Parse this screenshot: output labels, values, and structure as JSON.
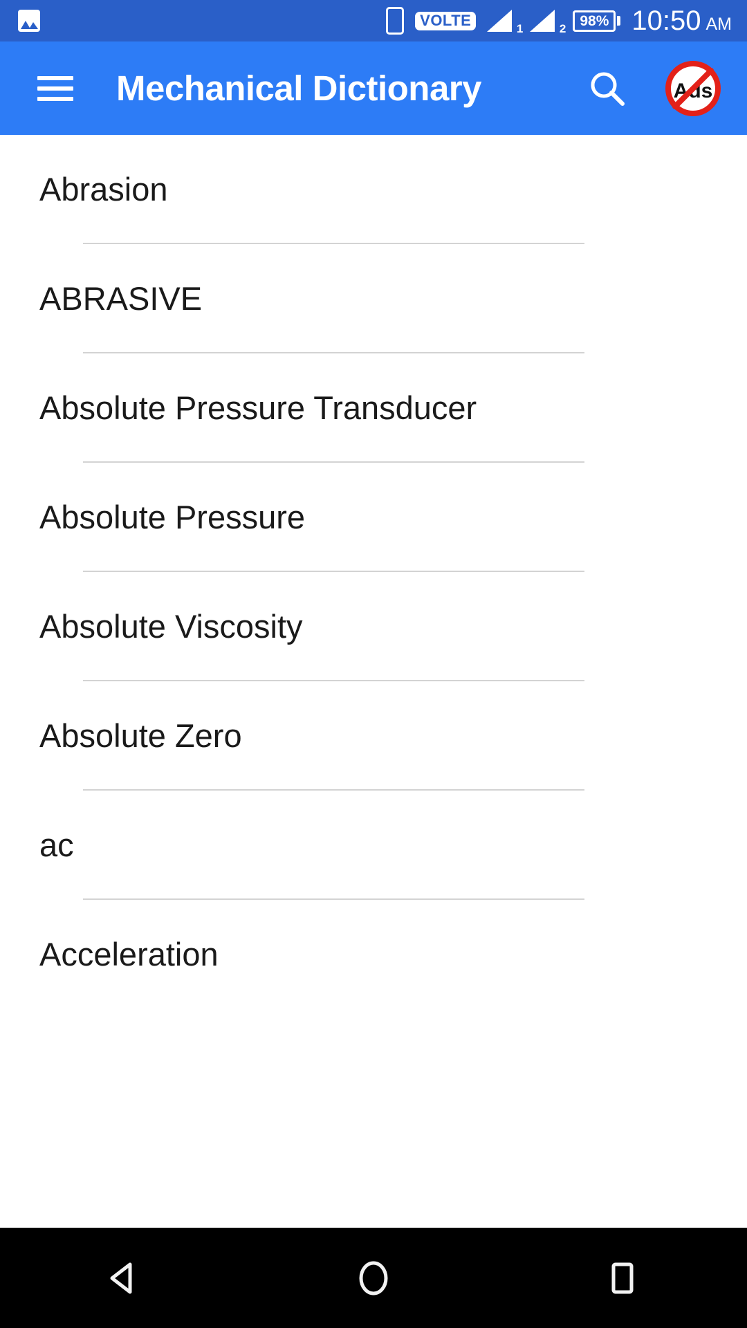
{
  "status_bar": {
    "background_color": "#2a5fc8",
    "notification_icon": "photo-icon",
    "sim_icon": "sim-card-icon",
    "volte_label": "VOLTE",
    "signal_1_label": "1",
    "signal_2_label": "2",
    "battery_percent": "98%",
    "time": "10:50",
    "am_pm": "AM"
  },
  "app_bar": {
    "background_color": "#2d7cf6",
    "menu_icon": "hamburger-menu-icon",
    "title": "Mechanical Dictionary",
    "search_icon": "search-icon",
    "remove_ads_icon": "no-ads-icon",
    "remove_ads_label": "Ads"
  },
  "list": {
    "items": [
      {
        "term": "Abrasion",
        "divider": true
      },
      {
        "term": "ABRASIVE",
        "divider": true
      },
      {
        "term": "Absolute Pressure Transducer",
        "divider": true
      },
      {
        "term": "Absolute Pressure",
        "divider": true
      },
      {
        "term": "Absolute Viscosity",
        "divider": true
      },
      {
        "term": "Absolute Zero",
        "divider": true
      },
      {
        "term": "ac",
        "divider": true
      },
      {
        "term": "Acceleration",
        "divider": false
      }
    ]
  },
  "nav_bar": {
    "background_color": "#000000",
    "back_icon": "back-triangle-icon",
    "home_icon": "home-circle-icon",
    "recents_icon": "recents-square-icon"
  }
}
